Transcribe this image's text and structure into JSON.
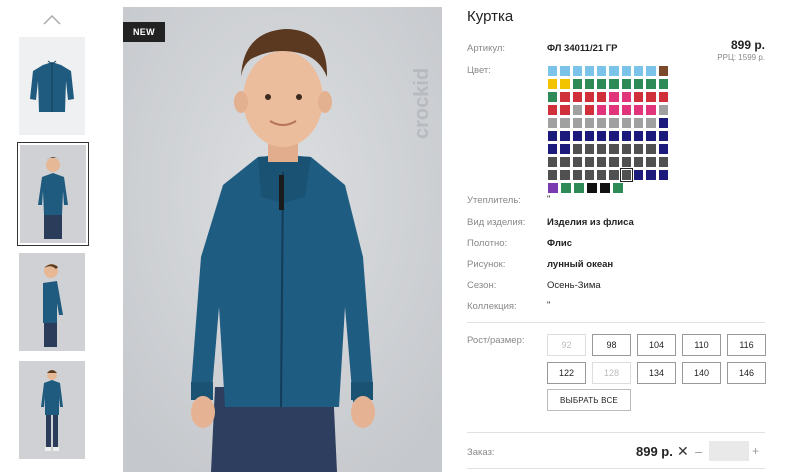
{
  "product": {
    "title": "Куртка",
    "badge": "NEW",
    "brand": "crockid",
    "price": "899 р.",
    "rrc": "РРЦ: 1599 р."
  },
  "thumbnails": [
    {
      "name": "thumb-flat-jacket",
      "selected": false
    },
    {
      "name": "thumb-boy-front",
      "selected": true
    },
    {
      "name": "thumb-boy-side",
      "selected": false
    },
    {
      "name": "thumb-boy-full",
      "selected": false
    }
  ],
  "attributes": {
    "article_label": "Артикул:",
    "article_value": "ФЛ 34011/21 ГР",
    "color_label": "Цвет:",
    "insulation_label": "Утеплитель:",
    "insulation_value": "\"",
    "type_label": "Вид изделия:",
    "type_value": "Изделия из флиса",
    "fabric_label": "Полотно:",
    "fabric_value": "Флис",
    "pattern_label": "Рисунок:",
    "pattern_value": "лунный океан",
    "season_label": "Сезон:",
    "season_value": "Осень-Зима",
    "collection_label": "Коллекция:",
    "collection_value": "\"",
    "size_label": "Рост/размер:"
  },
  "colors": {
    "rows": [
      [
        "#7cc3ea",
        "#7cc3ea",
        "#7cc3ea",
        "#7cc3ea",
        "#7cc3ea",
        "#7cc3ea",
        "#7cc3ea",
        "#7cc3ea",
        "#7cc3ea",
        "#7b4a2a"
      ],
      [
        "#f2c400",
        "#f2c400",
        "#2e8b57",
        "#2e8b57",
        "#2e8b57",
        "#2e8b57",
        "#2e8b57",
        "#2e8b57",
        "#2e8b57",
        "#2e8b57"
      ],
      [
        "#2e8b57",
        "#d0303a",
        "#d0303a",
        "#d0303a",
        "#d0303a",
        "#e0357a",
        "#e0357a",
        "#d0303a",
        "#d0303a",
        "#d0303a"
      ],
      [
        "#d0303a",
        "#d0303a",
        "#a0a0a0",
        "#d0303a",
        "#e0357a",
        "#e0357a",
        "#e0357a",
        "#e0357a",
        "#e0357a",
        "#a0a0a0"
      ],
      [
        "#a0a0a0",
        "#a0a0a0",
        "#a0a0a0",
        "#a0a0a0",
        "#a0a0a0",
        "#a0a0a0",
        "#a0a0a0",
        "#a0a0a0",
        "#a0a0a0",
        "#1c1a7a"
      ],
      [
        "#1c1a7a",
        "#1c1a7a",
        "#1c1a7a",
        "#1c1a7a",
        "#1c1a7a",
        "#1c1a7a",
        "#1c1a7a",
        "#1c1a7a",
        "#1c1a7a",
        "#1c1a7a"
      ],
      [
        "#1c1a7a",
        "#1c1a7a",
        "#505050",
        "#505050",
        "#505050",
        "#505050",
        "#505050",
        "#505050",
        "#505050",
        "#1c1a7a"
      ],
      [
        "#505050",
        "#505050",
        "#505050",
        "#505050",
        "#505050",
        "#505050",
        "#505050",
        "#505050",
        "#505050",
        "#505050"
      ],
      [
        "#505050",
        "#505050",
        "#505050",
        "#505050",
        "#505050",
        "#505050",
        "#505050",
        "#1c1a7a",
        "#1c1a7a",
        "#1c1a7a"
      ],
      [
        "#7b3bb0",
        "#2e8b57",
        "#2e8b57",
        "#111111",
        "#111111",
        "#2e8b57"
      ]
    ],
    "selected_row": 8,
    "selected_col": 6
  },
  "sizes": [
    [
      {
        "label": "92",
        "disabled": true
      },
      {
        "label": "98",
        "disabled": false
      },
      {
        "label": "104",
        "disabled": false
      },
      {
        "label": "110",
        "disabled": false
      },
      {
        "label": "116",
        "disabled": false
      }
    ],
    [
      {
        "label": "122",
        "disabled": false
      },
      {
        "label": "128",
        "disabled": true
      },
      {
        "label": "134",
        "disabled": false
      },
      {
        "label": "140",
        "disabled": false
      },
      {
        "label": "146",
        "disabled": false
      }
    ]
  ],
  "select_all_label": "ВЫБРАТЬ ВСЕ",
  "order": {
    "label": "Заказ:",
    "price": "899 р.",
    "remove_symbol": "✕",
    "minus": "–",
    "plus": "+",
    "qty": ""
  }
}
